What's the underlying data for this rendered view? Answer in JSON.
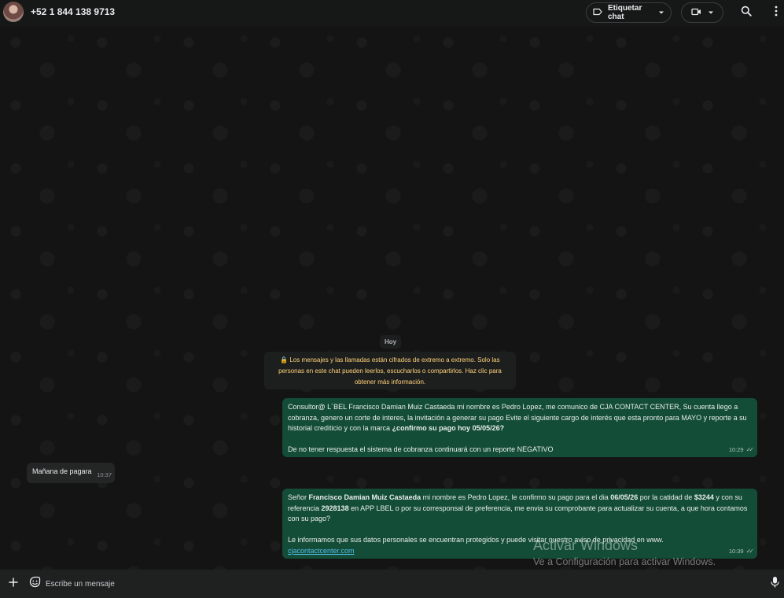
{
  "header": {
    "contact_name": "+52 1 844 138 9713",
    "label_button": "Etiquetar chat",
    "icons": [
      "avatar",
      "label-icon",
      "chevron-down-icon",
      "video-call-icon",
      "search-icon",
      "more-options-icon"
    ]
  },
  "chat": {
    "day_chip": "Hoy",
    "encryption_notice": "Los mensajes y las llamadas están cifrados de extremo a extremo. Solo las personas en este chat pueden leerlos, escucharlos o compartirlos. Haz clic para obtener más información.",
    "messages": [
      {
        "direction": "outgoing",
        "p1_a": "Consultor@ L´BEL Francisco Damian Muiz Castaeda mi nombre es Pedro Lopez, me comunico de CJA CONTACT CENTER, Su cuenta llego a cobranza, genero un corte de interes, la  invitación a generar su pago Evite el siguiente cargo de interés que esta pronto para MAYO y reporte a su historial crediticio y con la marca  ",
        "p1_bold": "¿confirmo su pago hoy 05/05/26?",
        "p2": "De no tener respuesta el sistema de cobranza continuará con un reporte NEGATIVO",
        "time": "10:29"
      },
      {
        "direction": "incoming",
        "text": "Mañana de pagara",
        "time": "10:37"
      },
      {
        "direction": "outgoing",
        "s1": "Señor ",
        "s2": "Francisco Damian Muiz Castaeda",
        "s3": " mi nombre es Pedro Lopez, le confirmo su pago para el dia ",
        "s4": "06/05/26",
        "s5": " por la catidad de ",
        "s6": "$3244",
        "s7": " y con su referencia ",
        "s8": "2928138",
        "s9": " en APP LBEL o por su corresponsal de preferencia, me envia su comprobante para actualizar su cuenta, a que hora contamos con su pago?",
        "p2": "Le informamos que sus datos personales se encuentran protegidos y puede visitar nuestro aviso de privacidad en www.",
        "link": "cjacontactcenter.com",
        "time": "10:39"
      }
    ]
  },
  "watermark": {
    "line1": "Activar Windows",
    "line2": "Ve a Configuración para activar Windows."
  },
  "composer": {
    "placeholder": "Escribe un mensaje",
    "icons": [
      "plus-icon",
      "emoji-sticker-icon",
      "microphone-icon"
    ]
  },
  "colors": {
    "outgoing_bubble": "#144d37",
    "incoming_bubble": "#242626",
    "notice_text": "#ffd279",
    "link": "#53bdeb"
  }
}
